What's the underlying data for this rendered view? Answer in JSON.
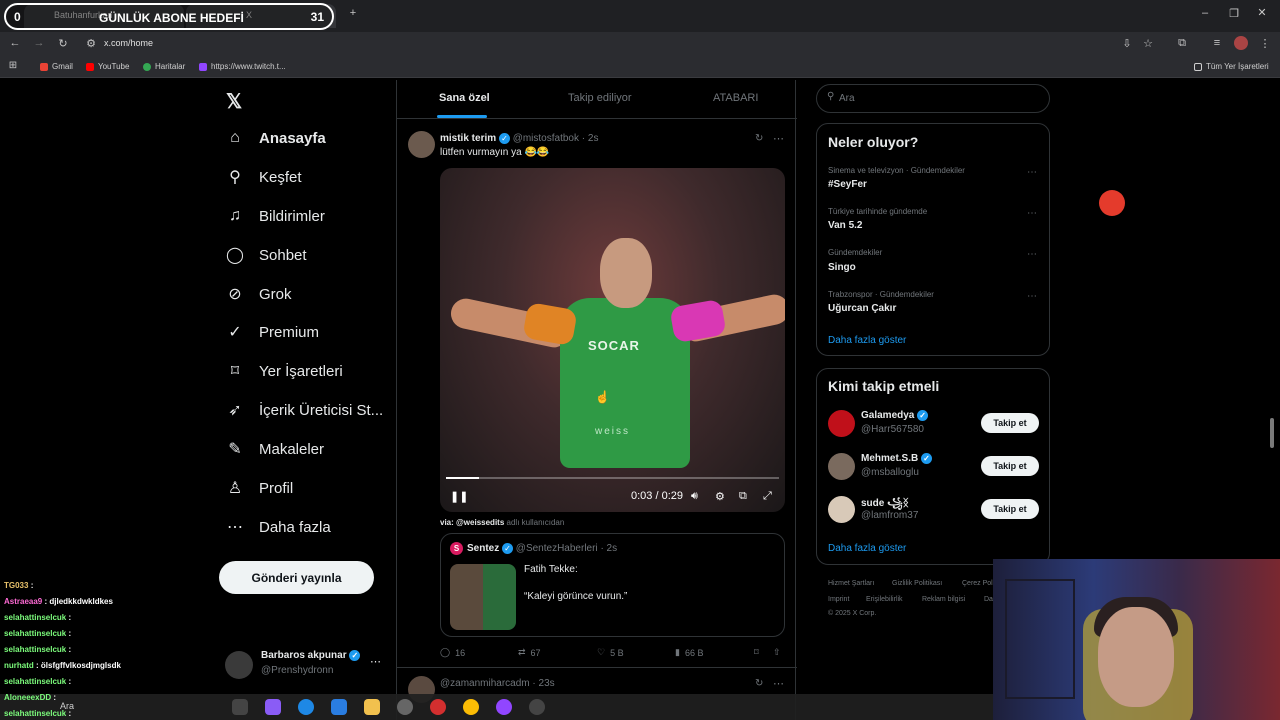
{
  "browser": {
    "tabs": [
      {
        "label": "Batuhanfurkan"
      },
      {
        "label": "X"
      }
    ],
    "url": "x.com/home",
    "bookmarks": [
      {
        "label": "Gmail",
        "color": "#ea4335"
      },
      {
        "label": "YouTube",
        "color": "#ff0000"
      },
      {
        "label": "Haritalar",
        "color": "#34a853"
      },
      {
        "label": "https://www.twitch.t...",
        "color": "#9146ff"
      }
    ],
    "all_bookmarks": "Tüm Yer İşaretleri"
  },
  "goal_overlay": {
    "title": "GÜNLÜK ABONE HEDEFİ",
    "current": "0",
    "target": "31"
  },
  "nav": {
    "items": [
      {
        "label": "Anasayfa",
        "icon": "home-icon"
      },
      {
        "label": "Keşfet",
        "icon": "search-icon"
      },
      {
        "label": "Bildirimler",
        "icon": "bell-icon"
      },
      {
        "label": "Sohbet",
        "icon": "chat-icon"
      },
      {
        "label": "Grok",
        "icon": "grok-icon"
      },
      {
        "label": "Premium",
        "icon": "premium-icon"
      },
      {
        "label": "Yer İşaretleri",
        "icon": "bookmark-icon"
      },
      {
        "label": "İçerik Üreticisi St...",
        "icon": "rocket-icon"
      },
      {
        "label": "Makaleler",
        "icon": "article-icon"
      },
      {
        "label": "Profil",
        "icon": "person-icon"
      },
      {
        "label": "Daha fazla",
        "icon": "more-circle-icon"
      }
    ],
    "post_button": "Gönderi yayınla",
    "account": {
      "name": "Barbaros akpunar",
      "handle": "@Prenshydronn"
    }
  },
  "feed": {
    "tabs": [
      "Sana özel",
      "Takip ediliyor",
      "ATABARI"
    ],
    "tweet": {
      "name": "mistik terim",
      "handle": "@mistosfatbok",
      "time": "· 2s",
      "text": "lütfen vurmayın ya 😂😂",
      "video": {
        "current": "0:03",
        "duration": "0:29",
        "time_display": "0:03 / 0:29",
        "progress": 0.1,
        "sponsor": "SOCAR",
        "mark": "weiss"
      },
      "via_handle": "via: @weissedits",
      "via_suffix": "adlı kullanıcıdan",
      "quote": {
        "name": "Sentez",
        "handle": "@SentezHaberleri",
        "time": "· 2s",
        "line1": "Fatih Tekke:",
        "line2": "“Kaleyi görünce vurun.”"
      },
      "actions": {
        "replies": "16",
        "retweets": "67",
        "likes": "5 B",
        "views": "66 B"
      }
    },
    "next_tweet": {
      "handle": "@zamanmiharcadm",
      "time": "· 23s"
    }
  },
  "sidebar": {
    "search_placeholder": "Ara",
    "trends_title": "Neler oluyor?",
    "trends": [
      {
        "meta": "Sinema ve televizyon · Gündemdekiler",
        "name": "#SeyFer"
      },
      {
        "meta": "Türkiye tarihinde gündemde",
        "name": "Van 5.2"
      },
      {
        "meta": "Gündemdekiler",
        "name": "Singo"
      },
      {
        "meta": "Trabzonspor · Gündemdekiler",
        "name": "Uğurcan Çakır"
      }
    ],
    "trends_more": "Daha fazla göster",
    "who_title": "Kimi takip etmeli",
    "suggestions": [
      {
        "name": "Galamedya",
        "handle": "@Harr567580",
        "button": "Takip et"
      },
      {
        "name": "Mehmet.S.B",
        "handle": "@msballoglu",
        "button": "Takip et"
      },
      {
        "name": "sude ꧁ᛝ",
        "handle": "@lamfrom37",
        "button": "Takip et"
      }
    ],
    "who_more": "Daha fazla göster",
    "footer": [
      "Hizmet Şartları",
      "Gizlilik Politikası",
      "Çerez Poli...",
      "Imprint",
      "Erişilebilirlik",
      "Reklam bilgisi",
      "Da...",
      "© 2025 X Corp."
    ]
  },
  "chat": [
    {
      "user": "TG033",
      "text": ":",
      "color": "#e8c26b"
    },
    {
      "user": "Astraeaa9",
      "text": ": djledkkdwkldkes",
      "color": "#ff6ad5"
    },
    {
      "user": "selahattinselcuk",
      "text": ":",
      "color": "#7cfc7c"
    },
    {
      "user": "selahattinselcuk",
      "text": ":",
      "color": "#7cfc7c"
    },
    {
      "user": "selahattinselcuk",
      "text": ":",
      "color": "#7cfc7c"
    },
    {
      "user": "nurhatd",
      "text": ": ölsfgffvlkosdjmglsdk",
      "color": "#7cfc7c"
    },
    {
      "user": "selahattinselcuk",
      "text": ":",
      "color": "#7cfc7c"
    },
    {
      "user": "AloneeexDD",
      "text": ":",
      "color": "#7cfc7c"
    },
    {
      "user": "selahattinselcuk",
      "text": ":",
      "color": "#7cfc7c"
    }
  ],
  "taskbar": {
    "search_label": "Ara"
  },
  "colors": {
    "accent": "#1d9bf0",
    "background": "#000000",
    "border": "#2f3336",
    "muted": "#71767b"
  }
}
